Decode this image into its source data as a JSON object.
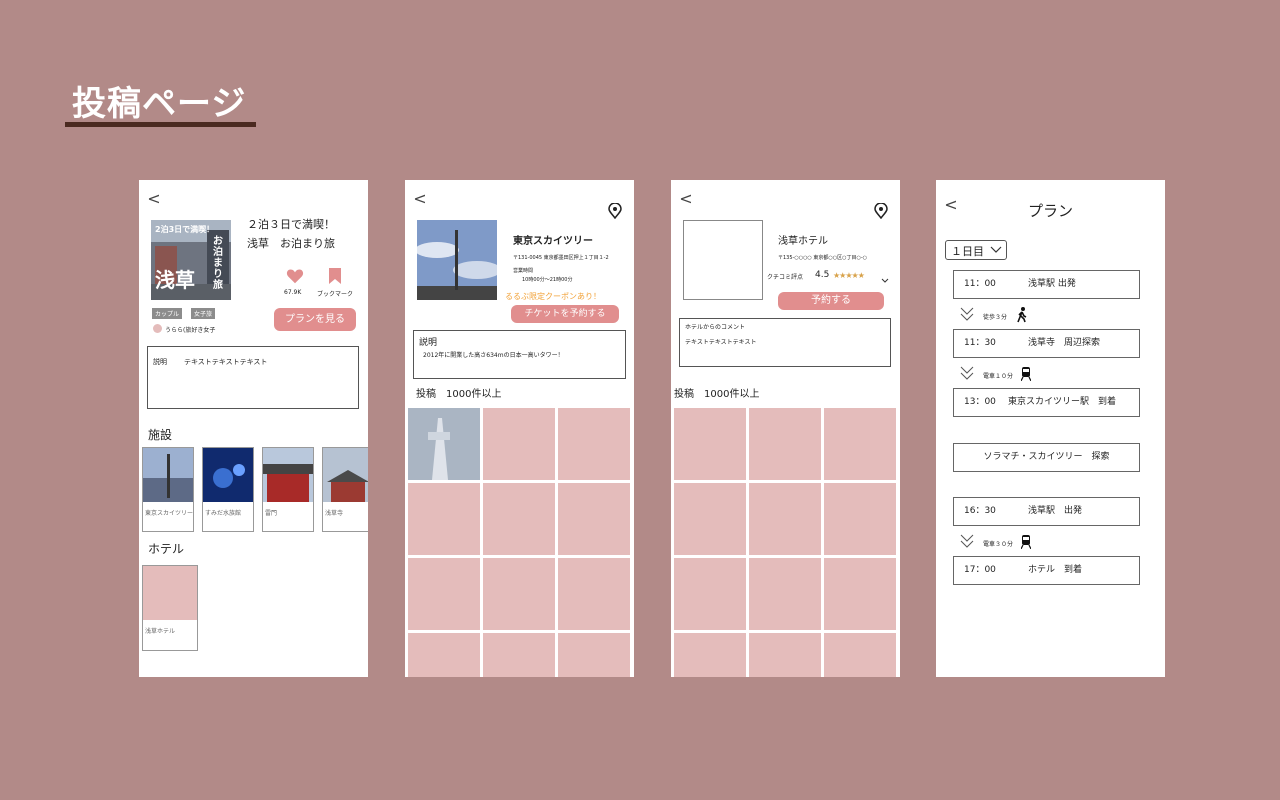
{
  "page": {
    "title": "投稿ページ"
  },
  "screen1": {
    "back": "<",
    "heading_line1": "２泊３日で満喫！",
    "heading_line2": "浅草　お泊まり旅",
    "thumb_text": {
      "top": "2泊3日で満喫！",
      "main": "浅草",
      "side": "お泊まり旅"
    },
    "like_count": "67.9K",
    "bookmark_label": "ブックマーク",
    "tags": [
      "カップル",
      "女子旅"
    ],
    "author": "うらら(旅好き女子",
    "view_plan_button": "プランを見る",
    "desc_label": "説明",
    "desc_text": "テキストテキストテキスト",
    "facility_heading": "施設",
    "facilities": [
      "東京スカイツリー",
      "すみだ水族館",
      "雷門",
      "浅草寺"
    ],
    "hotel_heading": "ホテル",
    "hotel_name": "浅草ホテル"
  },
  "screen2": {
    "back": "<",
    "name": "東京スカイツリー",
    "address": "〒131-0045 東京都墨田区押上１丁目１-2",
    "hours_label": "営業時間",
    "hours": "10時00分〜21時00分",
    "coupon": "るるぶ限定クーポンあり！",
    "ticket_button": "チケットを予約する",
    "desc_label": "説明",
    "desc_text": "2012年に開業した高さ634mの日本一高いタワー！",
    "posts_label": "投稿　1000件以上"
  },
  "screen3": {
    "back": "<",
    "name": "浅草ホテル",
    "address": "〒135-○○○○ 東京都○○区○丁目○-○",
    "rating_label": "クチコミ評点",
    "rating": "4.5",
    "stars": "★★★★★",
    "reserve_button": "予約する",
    "comment_label": "ホテルからのコメント",
    "comment_text": "テキストテキストテキスト",
    "posts_label": "投稿　1000件以上"
  },
  "screen4": {
    "back": "<",
    "title": "プラン",
    "day_select": "１日目",
    "rows": [
      {
        "time": "11：00",
        "place": "浅草駅 出発"
      },
      {
        "time": "11：30",
        "place": "浅草寺　周辺探索"
      },
      {
        "time": "13：00",
        "place": "東京スカイツリー駅　到着"
      },
      {
        "time": "",
        "place": "ソラマチ・スカイツリー　探索"
      },
      {
        "time": "16：30",
        "place": "浅草駅　出発"
      },
      {
        "time": "17：00",
        "place": "ホテル　到着"
      }
    ],
    "transit": [
      "徒歩３分",
      "電車１０分",
      "電車３０分"
    ]
  },
  "colors": {
    "background": "#b28a88",
    "accent_pink": "#e18e8e",
    "tile_pink": "#e4bcbb",
    "coupon_orange": "#f2a33a"
  }
}
